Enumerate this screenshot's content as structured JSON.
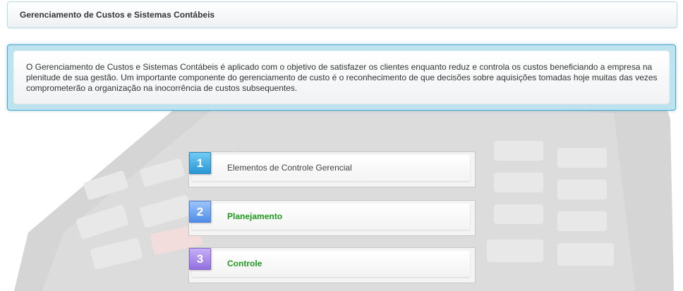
{
  "header": {
    "title": "Gerenciamento de Custos e Sistemas Contábeis"
  },
  "intro": {
    "text": "O Gerenciamento de Custos e Sistemas Contábeis é aplicado com o objetivo de satisfazer os clientes enquanto reduz e controla os custos beneficiando a empresa na plenitude de sua gestão.  Um importante componente do gerenciamento de custo é o reconhecimento de que decisões sobre aquisições tomadas hoje muitas das vezes comprometerão a organização na inocorrência de custos subsequentes."
  },
  "menu": {
    "items": [
      {
        "number": "1",
        "label": "Elementos de Controle Gerencial",
        "color": "#3aa9e0"
      },
      {
        "number": "2",
        "label": "Planejamento",
        "color": "#5b9bf0"
      },
      {
        "number": "3",
        "label": "Controle",
        "color": "#a47ee6"
      }
    ]
  },
  "colors": {
    "accent_border": "#4aa8cf",
    "link_green": "#1e9a1e"
  },
  "background": {
    "icon": "calculator-icon"
  }
}
